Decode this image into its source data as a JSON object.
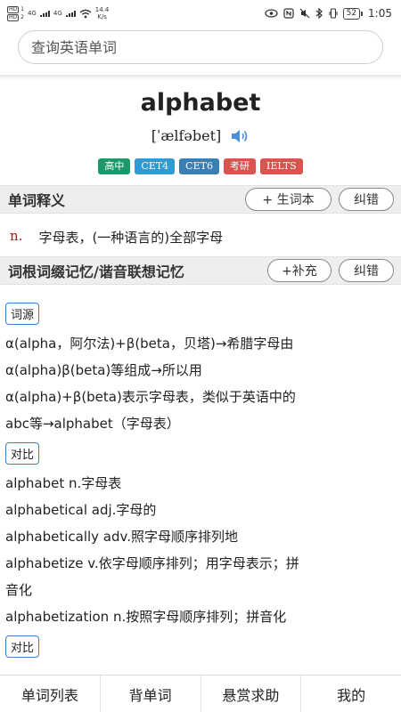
{
  "status_bar": {
    "sim1_label": "HD",
    "sim1_num": "1",
    "sim2_label": "HD",
    "sim2_num": "2",
    "network1": "4G",
    "network2": "4G",
    "speed_value": "14.4",
    "speed_unit": "K/s",
    "battery": "52",
    "time": "1:05"
  },
  "search": {
    "placeholder": "查询英语单词"
  },
  "word": {
    "text": "alphabet",
    "phonetic": "[ˈælfəbet]",
    "tags": [
      {
        "label": "高中",
        "color": "#1a9a6b"
      },
      {
        "label": "CET4",
        "color": "#2f9ad3"
      },
      {
        "label": "CET6",
        "color": "#3a7fb3"
      },
      {
        "label": "考研",
        "color": "#d9534f"
      },
      {
        "label": "IELTS",
        "color": "#d9534f"
      }
    ]
  },
  "definitions_section": {
    "title": "单词释义",
    "add_button": "+ 生词本",
    "report_button": "纠错"
  },
  "definition": {
    "pos": "n.",
    "meaning": "字母表，(一种语言的)全部字母"
  },
  "memory_section": {
    "title": "词根词缀记忆/谐音联想记忆",
    "add_button": "+补充",
    "report_button": "纠错"
  },
  "etymology": {
    "label": "词源",
    "lines": [
      "α(alpha，阿尔法)+β(beta，贝塔)→希腊字母由",
      "α(alpha)β(beta)等组成→所以用",
      "α(alpha)+β(beta)表示字母表，类似于英语中的",
      "abc等→alphabet（字母表）"
    ]
  },
  "compare1": {
    "label": "对比",
    "lines": [
      "alphabet n.字母表",
      "alphabetical adj.字母的",
      "alphabetically adv.照字母顺序排列地",
      "alphabetize v.依字母顺序排列；用字母表示；拼",
      "音化",
      "alphabetization n.按照字母顺序排列；拼音化"
    ]
  },
  "compare2": {
    "label": "对比"
  },
  "nav": {
    "items": [
      "单词列表",
      "背单词",
      "悬赏求助",
      "我的"
    ]
  },
  "colors": {
    "accent_border": "#3b7fc4",
    "pos_color": "#9b1c1c",
    "speaker_color": "#4a90d9"
  }
}
